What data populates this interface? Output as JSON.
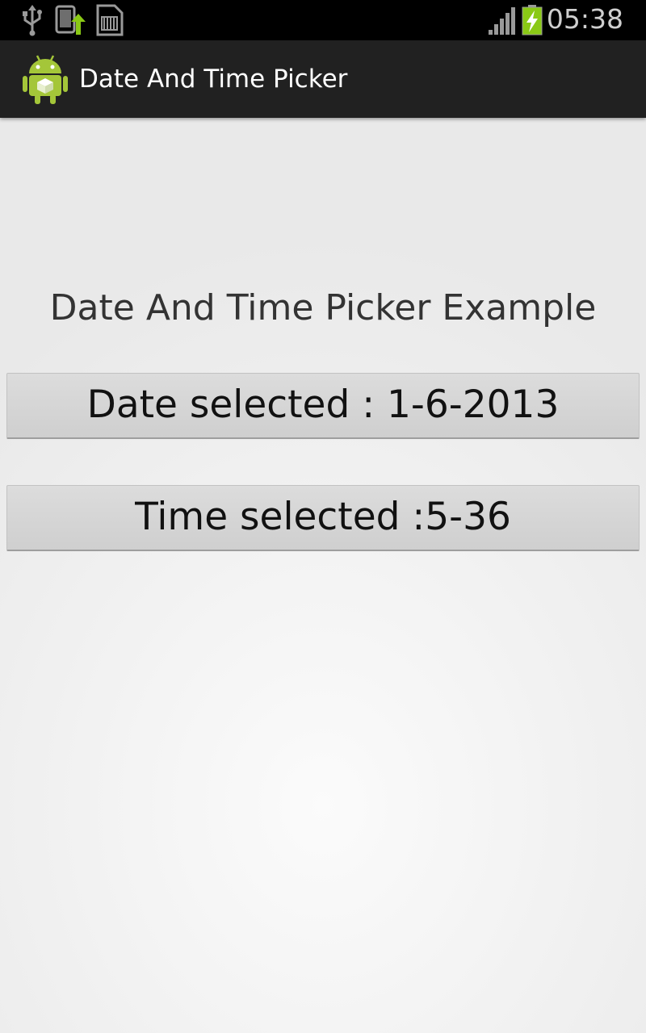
{
  "status_bar": {
    "time": "05:38",
    "icons": [
      "usb-icon",
      "phone-upload-icon",
      "sd-card-icon",
      "signal-icon",
      "battery-charging-icon"
    ]
  },
  "action_bar": {
    "app_icon": "android-robot-icon",
    "title": "Date And Time Picker"
  },
  "main": {
    "heading": "Date And Time Picker Example",
    "date_button_label": "Date selected : 1-6-2013",
    "time_button_label": "Time selected :5-36"
  },
  "colors": {
    "status_bar_bg": "#000000",
    "action_bar_bg": "#212121",
    "button_bg": "#d4d4d4",
    "battery_green": "#8ac915",
    "android_green": "#a4c639"
  }
}
